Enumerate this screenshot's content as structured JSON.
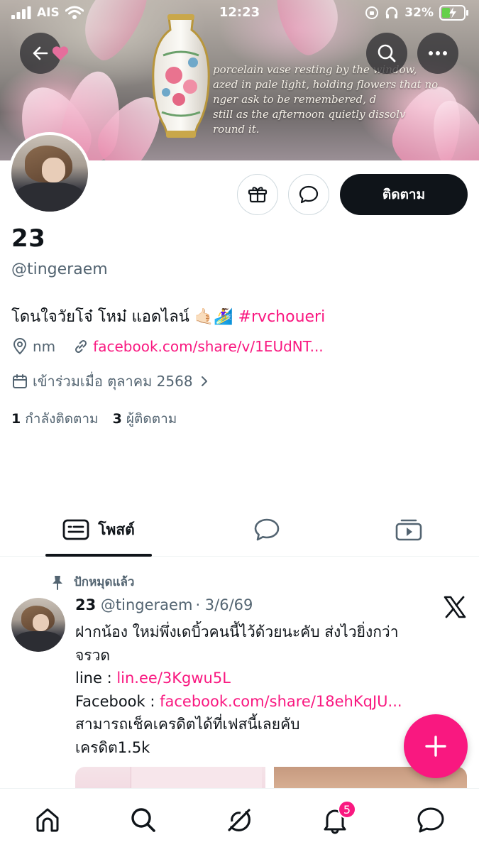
{
  "status_bar": {
    "carrier": "AIS",
    "time": "12:23",
    "battery_percent": "32%"
  },
  "banner": {
    "caption_lines": [
      "porcelain vase resting by the window,",
      "azed in pale light, holding flowers that no",
      "nger ask to be remembered, d",
      "still as the afternoon quietly dissolv",
      "round it."
    ]
  },
  "profile": {
    "display_name": "23",
    "handle": "@tingeraem",
    "bio_text": "โดนใจวัยโจ๋ โหม๋ แอดไลน์ 🤙🏻🏄‍♀️ ",
    "bio_hashtag": "#rvchoueri",
    "location": "nm",
    "website": "facebook.com/share/v/1EUdNT...",
    "joined": "เข้าร่วมเมื่อ ตุลาคม 2568",
    "following_count": "1",
    "following_label": "กำลังติดตาม",
    "followers_count": "3",
    "followers_label": "ผู้ติดตาม",
    "follow_button_label": "ติดตาม"
  },
  "tabs": {
    "posts_label": "โพสต์"
  },
  "pinned_post": {
    "pinned_label": "ปักหมุดแล้ว",
    "author_name": "23",
    "author_handle": "@tingeraem",
    "date": "· 3/6/69",
    "line1": "ฝากน้อง ใหม่พึ่งเดบิ้วคนนี้ไว้ด้วยนะคับ ส่งไวยิ่งกว่า",
    "line2": "จรวด",
    "line3_prefix": "line : ",
    "line3_link": "lin.ee/3Kgwu5L",
    "line4_prefix": "Facebook : ",
    "line4_link": "facebook.com/share/18ehKqJU...",
    "line5": "สามารถเช็คเครดิตได้ที่เฟสนี้เลยคับ",
    "line6": "เครดิต1.5k"
  },
  "bottom_nav": {
    "notifications_badge": "5"
  },
  "colors": {
    "accent": "#f91880",
    "text": "#0f1419",
    "muted": "#536471",
    "border": "#cfd9de"
  },
  "icons": [
    "back-arrow-icon",
    "heart-icon",
    "search-icon",
    "more-icon",
    "gift-icon",
    "message-icon",
    "location-icon",
    "link-icon",
    "calendar-icon",
    "chevron-right-icon",
    "posts-tab-icon",
    "replies-tab-icon",
    "media-tab-icon",
    "pin-icon",
    "x-logo-icon",
    "plus-icon",
    "home-icon",
    "search-nav-icon",
    "grok-icon",
    "bell-icon",
    "messages-icon"
  ]
}
